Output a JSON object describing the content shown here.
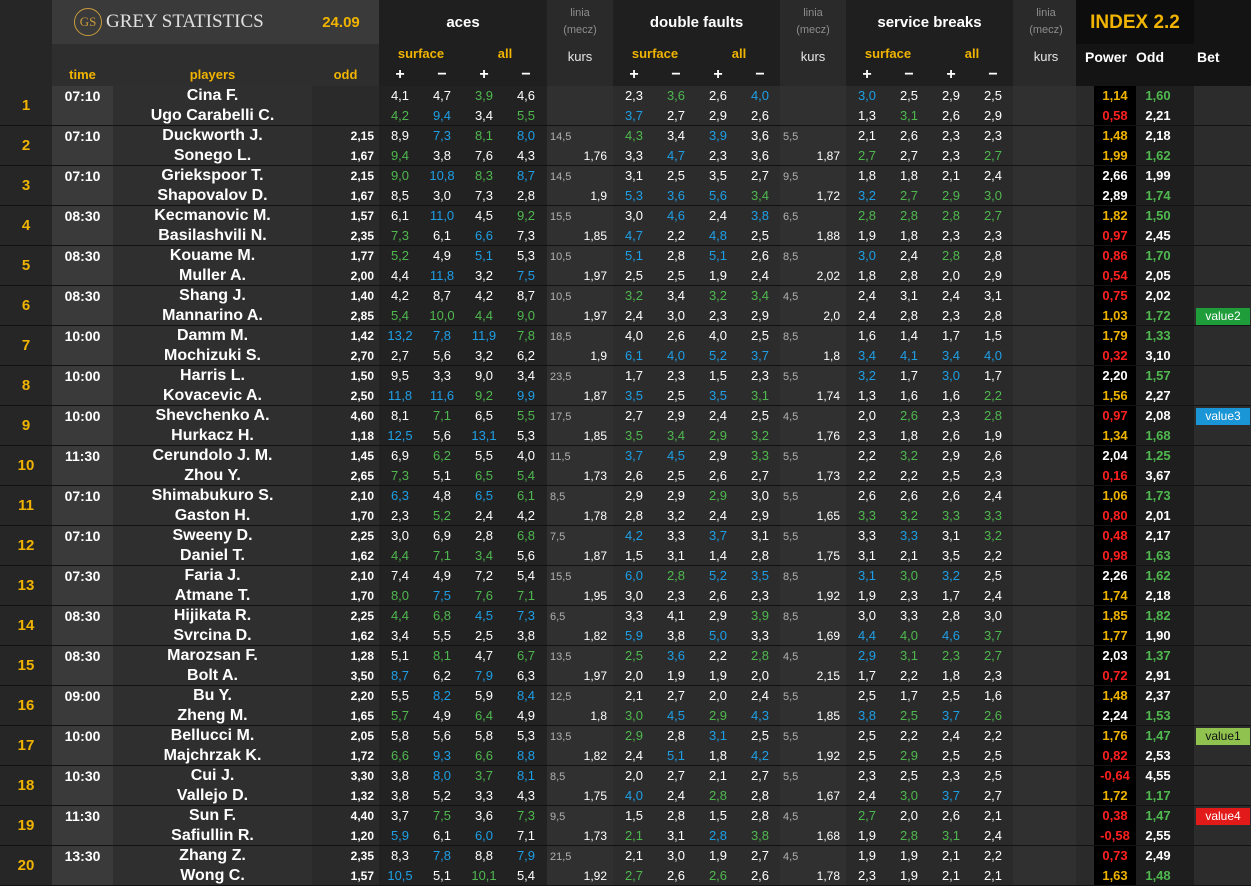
{
  "header": {
    "logo_mark": "GS",
    "logo_text": "GREY STATISTICS",
    "date": "24.09",
    "groups": {
      "aces": "aces",
      "double_faults": "double faults",
      "service_breaks": "service breaks"
    },
    "linia": "linia",
    "mecz": "(mecz)",
    "index_title": "INDEX 2.2",
    "surface": "surface",
    "all": "all",
    "kurs": "kurs",
    "power": "Power",
    "odd_col": "Odd",
    "bet": "Bet",
    "time": "time",
    "players": "players",
    "odd": "odd",
    "plus": "+",
    "minus": "−"
  },
  "colors": {
    "gold": "#f0b400",
    "white": "#ffffff",
    "blue": "#1e9fe6",
    "green": "#4fb84f",
    "red": "#ff2020",
    "grey": "#a8a8a8"
  },
  "matches": [
    {
      "no": "1",
      "time": "07:10",
      "p1": "Cina F.",
      "p2": "Ugo Carabelli C.",
      "o1": "",
      "o2": "",
      "a1": [
        "4,1",
        "4,7",
        "3,9",
        "4,6"
      ],
      "a2": [
        "4,2",
        "9,4",
        "3,4",
        "5,5"
      ],
      "al": "",
      "ak": "",
      "d1": [
        "2,3",
        "3,6",
        "2,6",
        "4,0"
      ],
      "d2": [
        "3,7",
        "2,7",
        "2,9",
        "2,6"
      ],
      "dl": "",
      "dk": "",
      "s1": [
        "3,0",
        "2,5",
        "2,9",
        "2,5"
      ],
      "s2": [
        "1,3",
        "3,1",
        "2,6",
        "2,9"
      ],
      "pw": [
        "1,14",
        "0,58"
      ],
      "od": [
        "1,60",
        "2,21"
      ],
      "bet": [
        "",
        ""
      ]
    },
    {
      "no": "2",
      "time": "07:10",
      "p1": "Duckworth J.",
      "p2": "Sonego L.",
      "o1": "2,15",
      "o2": "1,67",
      "a1": [
        "8,9",
        "7,3",
        "8,1",
        "8,0"
      ],
      "a2": [
        "9,4",
        "3,8",
        "7,6",
        "4,3"
      ],
      "al": "14,5",
      "ak": "1,76",
      "d1": [
        "4,3",
        "3,4",
        "3,9",
        "3,6"
      ],
      "d2": [
        "3,3",
        "4,7",
        "2,3",
        "3,6"
      ],
      "dl": "5,5",
      "dk": "1,87",
      "s1": [
        "2,1",
        "2,6",
        "2,3",
        "2,3"
      ],
      "s2": [
        "2,7",
        "2,7",
        "2,3",
        "2,7"
      ],
      "pw": [
        "1,48",
        "1,99"
      ],
      "od": [
        "2,18",
        "1,62"
      ],
      "bet": [
        "",
        ""
      ]
    },
    {
      "no": "3",
      "time": "07:10",
      "p1": "Griekspoor T.",
      "p2": "Shapovalov D.",
      "o1": "2,15",
      "o2": "1,67",
      "a1": [
        "9,0",
        "10,8",
        "8,3",
        "8,7"
      ],
      "a2": [
        "8,5",
        "3,0",
        "7,3",
        "2,8"
      ],
      "al": "14,5",
      "ak": "1,9",
      "d1": [
        "3,1",
        "2,5",
        "3,5",
        "2,7"
      ],
      "d2": [
        "5,3",
        "3,6",
        "5,6",
        "3,4"
      ],
      "dl": "9,5",
      "dk": "1,72",
      "s1": [
        "1,8",
        "1,8",
        "2,1",
        "2,4"
      ],
      "s2": [
        "3,2",
        "2,7",
        "2,9",
        "3,0"
      ],
      "pw": [
        "2,66",
        "2,89"
      ],
      "od": [
        "1,99",
        "1,74"
      ],
      "bet": [
        "",
        ""
      ]
    },
    {
      "no": "4",
      "time": "08:30",
      "p1": "Kecmanovic M.",
      "p2": "Basilashvili N.",
      "o1": "1,57",
      "o2": "2,35",
      "a1": [
        "6,1",
        "11,0",
        "4,5",
        "9,2"
      ],
      "a2": [
        "7,3",
        "6,1",
        "6,6",
        "7,3"
      ],
      "al": "15,5",
      "ak": "1,85",
      "d1": [
        "3,0",
        "4,6",
        "2,4",
        "3,8"
      ],
      "d2": [
        "4,7",
        "2,2",
        "4,8",
        "2,5"
      ],
      "dl": "6,5",
      "dk": "1,88",
      "s1": [
        "2,8",
        "2,8",
        "2,8",
        "2,7"
      ],
      "s2": [
        "1,9",
        "1,8",
        "2,3",
        "2,3"
      ],
      "pw": [
        "1,82",
        "0,97"
      ],
      "od": [
        "1,50",
        "2,45"
      ],
      "bet": [
        "",
        ""
      ]
    },
    {
      "no": "5",
      "time": "08:30",
      "p1": "Kouame M.",
      "p2": "Muller A.",
      "o1": "1,77",
      "o2": "2,00",
      "a1": [
        "5,2",
        "4,9",
        "5,1",
        "5,3"
      ],
      "a2": [
        "4,4",
        "11,8",
        "3,2",
        "7,5"
      ],
      "al": "10,5",
      "ak": "1,97",
      "d1": [
        "5,1",
        "2,8",
        "5,1",
        "2,6"
      ],
      "d2": [
        "2,5",
        "2,5",
        "1,9",
        "2,4"
      ],
      "dl": "8,5",
      "dk": "2,02",
      "s1": [
        "3,0",
        "2,4",
        "2,8",
        "2,8"
      ],
      "s2": [
        "1,8",
        "2,8",
        "2,0",
        "2,9"
      ],
      "pw": [
        "0,86",
        "0,54"
      ],
      "od": [
        "1,70",
        "2,05"
      ],
      "bet": [
        "",
        ""
      ]
    },
    {
      "no": "6",
      "time": "08:30",
      "p1": "Shang J.",
      "p2": "Mannarino A.",
      "o1": "1,40",
      "o2": "2,85",
      "a1": [
        "4,2",
        "8,7",
        "4,2",
        "8,7"
      ],
      "a2": [
        "5,4",
        "10,0",
        "4,4",
        "9,0"
      ],
      "al": "10,5",
      "ak": "1,97",
      "d1": [
        "3,2",
        "3,4",
        "3,2",
        "3,4"
      ],
      "d2": [
        "2,4",
        "3,0",
        "2,3",
        "2,9"
      ],
      "dl": "4,5",
      "dk": "2,0",
      "s1": [
        "2,4",
        "3,1",
        "2,4",
        "3,1"
      ],
      "s2": [
        "2,4",
        "2,8",
        "2,3",
        "2,8"
      ],
      "pw": [
        "0,75",
        "1,03"
      ],
      "od": [
        "2,02",
        "1,72"
      ],
      "bet": [
        "",
        "value2"
      ]
    },
    {
      "no": "7",
      "time": "10:00",
      "p1": "Damm M.",
      "p2": "Mochizuki S.",
      "o1": "1,42",
      "o2": "2,70",
      "a1": [
        "13,2",
        "7,8",
        "11,9",
        "7,8"
      ],
      "a2": [
        "2,7",
        "5,6",
        "3,2",
        "6,2"
      ],
      "al": "18,5",
      "ak": "1,9",
      "d1": [
        "4,0",
        "2,6",
        "4,0",
        "2,5"
      ],
      "d2": [
        "6,1",
        "4,0",
        "5,2",
        "3,7"
      ],
      "dl": "8,5",
      "dk": "1,8",
      "s1": [
        "1,6",
        "1,4",
        "1,7",
        "1,5"
      ],
      "s2": [
        "3,4",
        "4,1",
        "3,4",
        "4,0"
      ],
      "pw": [
        "1,79",
        "0,32"
      ],
      "od": [
        "1,33",
        "3,10"
      ],
      "bet": [
        "",
        ""
      ]
    },
    {
      "no": "8",
      "time": "10:00",
      "p1": "Harris L.",
      "p2": "Kovacevic A.",
      "o1": "1,50",
      "o2": "2,50",
      "a1": [
        "9,5",
        "3,3",
        "9,0",
        "3,4"
      ],
      "a2": [
        "11,8",
        "11,6",
        "9,2",
        "9,9"
      ],
      "al": "23,5",
      "ak": "1,87",
      "d1": [
        "1,7",
        "2,3",
        "1,5",
        "2,3"
      ],
      "d2": [
        "3,5",
        "2,5",
        "3,5",
        "3,1"
      ],
      "dl": "5,5",
      "dk": "1,74",
      "s1": [
        "3,2",
        "1,7",
        "3,0",
        "1,7"
      ],
      "s2": [
        "1,3",
        "1,6",
        "1,6",
        "2,2"
      ],
      "pw": [
        "2,20",
        "1,56"
      ],
      "od": [
        "1,57",
        "2,27"
      ],
      "bet": [
        "",
        ""
      ]
    },
    {
      "no": "9",
      "time": "10:00",
      "p1": "Shevchenko A.",
      "p2": "Hurkacz H.",
      "o1": "4,60",
      "o2": "1,18",
      "a1": [
        "8,1",
        "7,1",
        "6,5",
        "5,5"
      ],
      "a2": [
        "12,5",
        "5,6",
        "13,1",
        "5,3"
      ],
      "al": "17,5",
      "ak": "1,85",
      "d1": [
        "2,7",
        "2,9",
        "2,4",
        "2,5"
      ],
      "d2": [
        "3,5",
        "3,4",
        "2,9",
        "3,2"
      ],
      "dl": "4,5",
      "dk": "1,76",
      "s1": [
        "2,0",
        "2,6",
        "2,3",
        "2,8"
      ],
      "s2": [
        "2,3",
        "1,8",
        "2,6",
        "1,9"
      ],
      "pw": [
        "0,97",
        "1,34"
      ],
      "od": [
        "2,08",
        "1,68"
      ],
      "bet": [
        "value3",
        ""
      ]
    },
    {
      "no": "10",
      "time": "11:30",
      "p1": "Cerundolo J. M.",
      "p2": "Zhou Y.",
      "o1": "1,45",
      "o2": "2,65",
      "a1": [
        "6,9",
        "6,2",
        "5,5",
        "4,0"
      ],
      "a2": [
        "7,3",
        "5,1",
        "6,5",
        "5,4"
      ],
      "al": "11,5",
      "ak": "1,73",
      "d1": [
        "3,7",
        "4,5",
        "2,9",
        "3,3"
      ],
      "d2": [
        "2,6",
        "2,5",
        "2,6",
        "2,7"
      ],
      "dl": "5,5",
      "dk": "1,73",
      "s1": [
        "2,2",
        "3,2",
        "2,9",
        "2,6"
      ],
      "s2": [
        "2,2",
        "2,2",
        "2,5",
        "2,3"
      ],
      "pw": [
        "2,04",
        "0,16"
      ],
      "od": [
        "1,25",
        "3,67"
      ],
      "bet": [
        "",
        ""
      ]
    },
    {
      "no": "11",
      "time": "07:10",
      "p1": "Shimabukuro S.",
      "p2": "Gaston H.",
      "o1": "2,10",
      "o2": "1,70",
      "a1": [
        "6,3",
        "4,8",
        "6,5",
        "6,1"
      ],
      "a2": [
        "2,3",
        "5,2",
        "2,4",
        "4,2"
      ],
      "al": "8,5",
      "ak": "1,78",
      "d1": [
        "2,9",
        "2,9",
        "2,9",
        "3,0"
      ],
      "d2": [
        "2,8",
        "3,2",
        "2,4",
        "2,9"
      ],
      "dl": "5,5",
      "dk": "1,65",
      "s1": [
        "2,6",
        "2,6",
        "2,6",
        "2,4"
      ],
      "s2": [
        "3,3",
        "3,2",
        "3,3",
        "3,3"
      ],
      "pw": [
        "1,06",
        "0,80"
      ],
      "od": [
        "1,73",
        "2,01"
      ],
      "bet": [
        "",
        ""
      ]
    },
    {
      "no": "12",
      "time": "07:10",
      "p1": "Sweeny D.",
      "p2": "Daniel T.",
      "o1": "2,25",
      "o2": "1,62",
      "a1": [
        "3,0",
        "6,9",
        "2,8",
        "6,8"
      ],
      "a2": [
        "4,4",
        "7,1",
        "3,4",
        "5,6"
      ],
      "al": "7,5",
      "ak": "1,87",
      "d1": [
        "4,2",
        "3,3",
        "3,7",
        "3,1"
      ],
      "d2": [
        "1,5",
        "3,1",
        "1,4",
        "2,8"
      ],
      "dl": "5,5",
      "dk": "1,75",
      "s1": [
        "3,3",
        "3,3",
        "3,1",
        "3,2"
      ],
      "s2": [
        "3,1",
        "2,1",
        "3,5",
        "2,2"
      ],
      "pw": [
        "0,48",
        "0,98"
      ],
      "od": [
        "2,17",
        "1,63"
      ],
      "bet": [
        "",
        ""
      ]
    },
    {
      "no": "13",
      "time": "07:30",
      "p1": "Faria J.",
      "p2": "Atmane T.",
      "o1": "2,10",
      "o2": "1,70",
      "a1": [
        "7,4",
        "4,9",
        "7,2",
        "5,4"
      ],
      "a2": [
        "8,0",
        "7,5",
        "7,6",
        "7,1"
      ],
      "al": "15,5",
      "ak": "1,95",
      "d1": [
        "6,0",
        "2,8",
        "5,2",
        "3,5"
      ],
      "d2": [
        "3,0",
        "2,3",
        "2,6",
        "2,3"
      ],
      "dl": "8,5",
      "dk": "1,92",
      "s1": [
        "3,1",
        "3,0",
        "3,2",
        "2,5"
      ],
      "s2": [
        "1,9",
        "2,3",
        "1,7",
        "2,4"
      ],
      "pw": [
        "2,26",
        "1,74"
      ],
      "od": [
        "1,62",
        "2,18"
      ],
      "bet": [
        "",
        ""
      ]
    },
    {
      "no": "14",
      "time": "08:30",
      "p1": "Hijikata R.",
      "p2": "Svrcina D.",
      "o1": "2,25",
      "o2": "1,62",
      "a1": [
        "4,4",
        "6,8",
        "4,5",
        "7,3"
      ],
      "a2": [
        "3,4",
        "5,5",
        "2,5",
        "3,8"
      ],
      "al": "6,5",
      "ak": "1,82",
      "d1": [
        "3,3",
        "4,1",
        "2,9",
        "3,9"
      ],
      "d2": [
        "5,9",
        "3,8",
        "5,0",
        "3,3"
      ],
      "dl": "8,5",
      "dk": "1,69",
      "s1": [
        "3,0",
        "3,3",
        "2,8",
        "3,0"
      ],
      "s2": [
        "4,4",
        "4,0",
        "4,6",
        "3,7"
      ],
      "pw": [
        "1,85",
        "1,77"
      ],
      "od": [
        "1,82",
        "1,90"
      ],
      "bet": [
        "",
        ""
      ]
    },
    {
      "no": "15",
      "time": "08:30",
      "p1": "Marozsan F.",
      "p2": "Bolt A.",
      "o1": "1,28",
      "o2": "3,50",
      "a1": [
        "5,1",
        "8,1",
        "4,7",
        "6,7"
      ],
      "a2": [
        "8,7",
        "6,2",
        "7,9",
        "6,3"
      ],
      "al": "13,5",
      "ak": "1,97",
      "d1": [
        "2,5",
        "3,6",
        "2,2",
        "2,8"
      ],
      "d2": [
        "2,0",
        "1,9",
        "1,9",
        "2,0"
      ],
      "dl": "4,5",
      "dk": "2,15",
      "s1": [
        "2,9",
        "3,1",
        "2,3",
        "2,7"
      ],
      "s2": [
        "1,7",
        "2,2",
        "1,8",
        "2,3"
      ],
      "pw": [
        "2,03",
        "0,72"
      ],
      "od": [
        "1,37",
        "2,91"
      ],
      "bet": [
        "",
        ""
      ]
    },
    {
      "no": "16",
      "time": "09:00",
      "p1": "Bu Y.",
      "p2": "Zheng M.",
      "o1": "2,20",
      "o2": "1,65",
      "a1": [
        "5,5",
        "8,2",
        "5,9",
        "8,4"
      ],
      "a2": [
        "5,7",
        "4,9",
        "6,4",
        "4,9"
      ],
      "al": "12,5",
      "ak": "1,8",
      "d1": [
        "2,1",
        "2,7",
        "2,0",
        "2,4"
      ],
      "d2": [
        "3,0",
        "4,5",
        "2,9",
        "4,3"
      ],
      "dl": "5,5",
      "dk": "1,85",
      "s1": [
        "2,5",
        "1,7",
        "2,5",
        "1,6"
      ],
      "s2": [
        "3,8",
        "2,5",
        "3,7",
        "2,6"
      ],
      "pw": [
        "1,48",
        "2,24"
      ],
      "od": [
        "2,37",
        "1,53"
      ],
      "bet": [
        "",
        ""
      ]
    },
    {
      "no": "17",
      "time": "10:00",
      "p1": "Bellucci M.",
      "p2": "Majchrzak K.",
      "o1": "2,05",
      "o2": "1,72",
      "a1": [
        "5,8",
        "5,6",
        "5,8",
        "5,3"
      ],
      "a2": [
        "6,6",
        "9,3",
        "6,6",
        "8,8"
      ],
      "al": "13,5",
      "ak": "1,82",
      "d1": [
        "2,9",
        "2,8",
        "3,1",
        "2,5"
      ],
      "d2": [
        "2,4",
        "5,1",
        "1,8",
        "4,2"
      ],
      "dl": "5,5",
      "dk": "1,92",
      "s1": [
        "2,5",
        "2,2",
        "2,4",
        "2,2"
      ],
      "s2": [
        "2,5",
        "2,9",
        "2,5",
        "2,5"
      ],
      "pw": [
        "1,76",
        "0,82"
      ],
      "od": [
        "1,47",
        "2,53"
      ],
      "bet": [
        "value1",
        ""
      ]
    },
    {
      "no": "18",
      "time": "10:30",
      "p1": "Cui J.",
      "p2": "Vallejo D.",
      "o1": "3,30",
      "o2": "1,32",
      "a1": [
        "3,8",
        "8,0",
        "3,7",
        "8,1"
      ],
      "a2": [
        "3,8",
        "5,2",
        "3,3",
        "4,3"
      ],
      "al": "8,5",
      "ak": "1,75",
      "d1": [
        "2,0",
        "2,7",
        "2,1",
        "2,7"
      ],
      "d2": [
        "4,0",
        "2,4",
        "2,8",
        "2,8"
      ],
      "dl": "5,5",
      "dk": "1,67",
      "s1": [
        "2,3",
        "2,5",
        "2,3",
        "2,5"
      ],
      "s2": [
        "2,4",
        "3,0",
        "3,7",
        "2,7"
      ],
      "pw": [
        "-0,64",
        "1,72"
      ],
      "od": [
        "4,55",
        "1,17"
      ],
      "bet": [
        "",
        ""
      ]
    },
    {
      "no": "19",
      "time": "11:30",
      "p1": "Sun F.",
      "p2": "Safiullin R.",
      "o1": "4,40",
      "o2": "1,20",
      "a1": [
        "3,7",
        "7,5",
        "3,6",
        "7,3"
      ],
      "a2": [
        "5,9",
        "6,1",
        "6,0",
        "7,1"
      ],
      "al": "9,5",
      "ak": "1,73",
      "d1": [
        "1,5",
        "2,8",
        "1,5",
        "2,8"
      ],
      "d2": [
        "2,1",
        "3,1",
        "2,8",
        "3,8"
      ],
      "dl": "4,5",
      "dk": "1,68",
      "s1": [
        "2,7",
        "2,0",
        "2,6",
        "2,1"
      ],
      "s2": [
        "1,9",
        "2,8",
        "3,1",
        "2,4"
      ],
      "pw": [
        "0,38",
        "-0,58"
      ],
      "od": [
        "1,47",
        "2,55"
      ],
      "bet": [
        "value4",
        ""
      ]
    },
    {
      "no": "20",
      "time": "13:30",
      "p1": "Zhang Z.",
      "p2": "Wong C.",
      "o1": "2,35",
      "o2": "1,57",
      "a1": [
        "8,3",
        "7,8",
        "8,8",
        "7,9"
      ],
      "a2": [
        "10,5",
        "5,1",
        "10,1",
        "5,4"
      ],
      "al": "21,5",
      "ak": "1,92",
      "d1": [
        "2,1",
        "3,0",
        "1,9",
        "2,7"
      ],
      "d2": [
        "2,7",
        "2,6",
        "2,6",
        "2,6"
      ],
      "dl": "4,5",
      "dk": "1,78",
      "s1": [
        "1,9",
        "1,9",
        "2,1",
        "2,2"
      ],
      "s2": [
        "2,3",
        "1,9",
        "2,1",
        "2,1"
      ],
      "pw": [
        "0,73",
        "1,63"
      ],
      "od": [
        "2,49",
        "1,48"
      ],
      "bet": [
        "",
        ""
      ]
    }
  ]
}
